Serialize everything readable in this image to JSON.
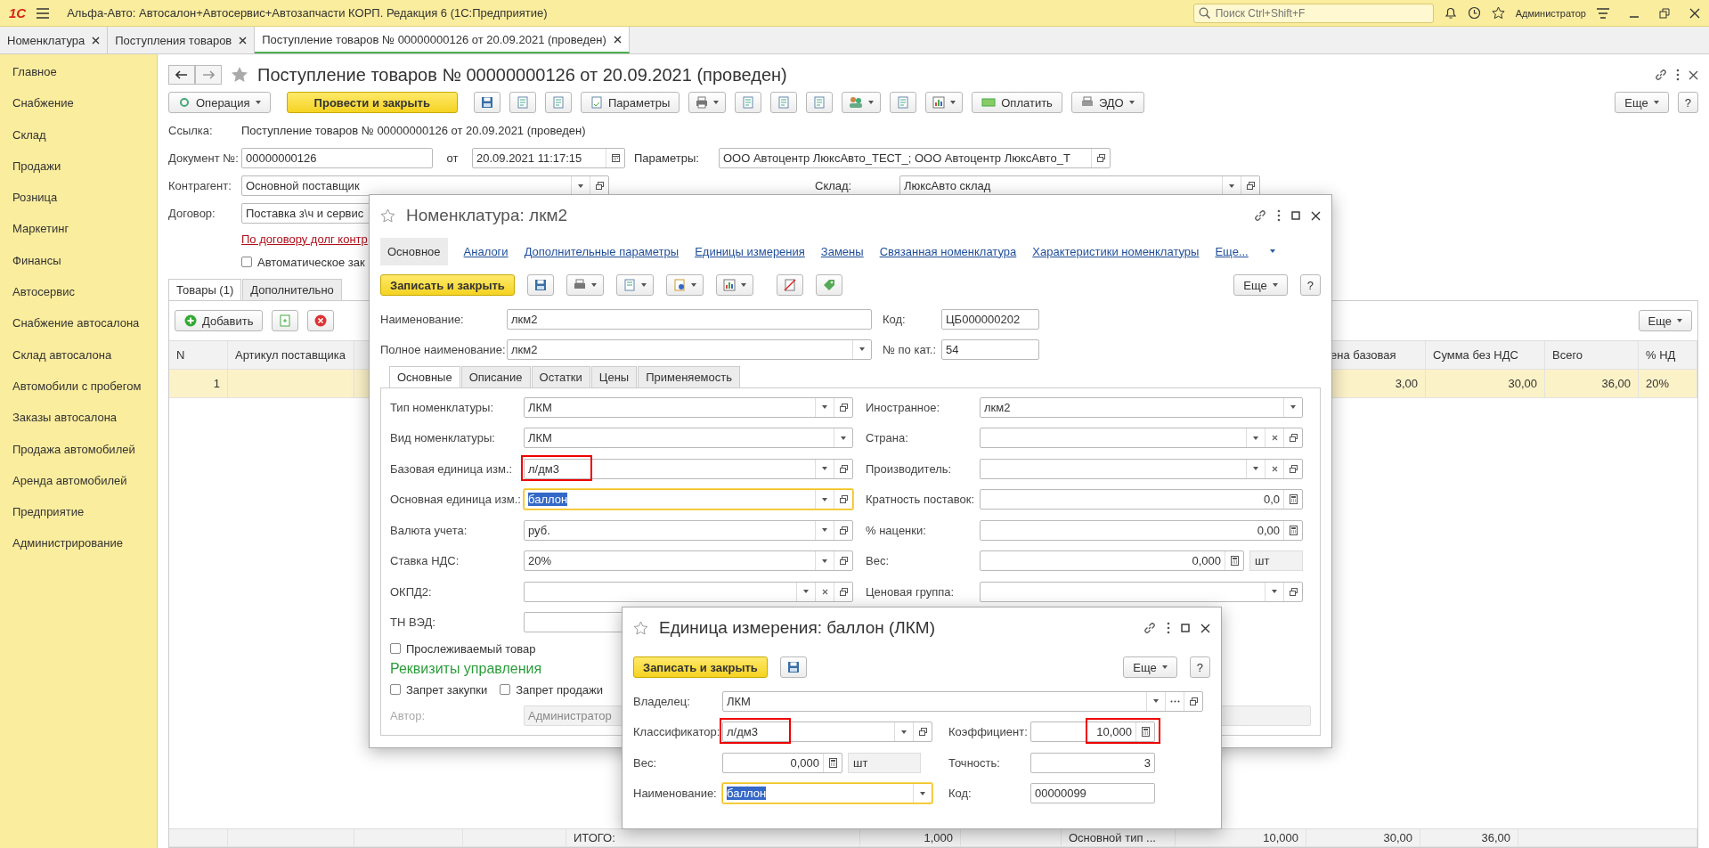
{
  "app_bar": {
    "logo": "1С",
    "title": "Альфа-Авто: Автосалон+Автосервис+Автозапчасти КОРП. Редакция 6  (1С:Предприятие)",
    "search_placeholder": "Поиск Ctrl+Shift+F",
    "user": "Администратор"
  },
  "open_tabs": [
    {
      "label": "Номенклатура",
      "selected": false
    },
    {
      "label": "Поступления товаров",
      "selected": false
    },
    {
      "label": "Поступление товаров № 00000000126 от 20.09.2021 (проведен)",
      "selected": true
    }
  ],
  "sidebar": {
    "items": [
      "Главное",
      "Снабжение",
      "Склад",
      "Продажи",
      "Розница",
      "Маркетинг",
      "Финансы",
      "Автосервис",
      "Снабжение автосалона",
      "Склад автосалона",
      "Автомобили с пробегом",
      "Заказы автосалона",
      "Продажа автомобилей",
      "Аренда автомобилей",
      "Предприятие",
      "Администрирование"
    ]
  },
  "document": {
    "title": "Поступление товаров № 00000000126 от 20.09.2021 (проведен)",
    "toolbar": {
      "operation": "Операция",
      "post": "Провести и закрыть",
      "params": "Параметры",
      "pay": "Оплатить",
      "edo": "ЭДО",
      "more": "Еще",
      "help": "?"
    },
    "link_label": "Ссылка:",
    "link_value": "Поступление товаров № 00000000126 от 20.09.2021 (проведен)",
    "number": {
      "label": "Документ №:",
      "value": "00000000126",
      "kind": "text"
    },
    "date": {
      "label": "от",
      "value": "20.09.2021 11:17:15",
      "kind": "date"
    },
    "params": {
      "label": "Параметры:",
      "value": "ООО Автоцентр ЛюксАвто_ТЕСТ_; ООО Автоцентр ЛюксАвто_Т",
      "kind": "ref"
    },
    "counterparty": {
      "label": "Контрагент:",
      "value": "Основной поставщик",
      "kind": "combo"
    },
    "warehouse": {
      "label": "Склад:",
      "value": "ЛюксАвто склад",
      "kind": "combo"
    },
    "contract": {
      "label": "Договор:",
      "value": "Поставка з\\ч и сервис",
      "kind": "text"
    },
    "debt_link": "По договору долг контр",
    "auto_checkbox": {
      "label": "Автоматическое зак",
      "checked": false
    },
    "tabs": [
      {
        "label": "Товары (1)",
        "selected": true
      },
      {
        "label": "Дополнительно",
        "selected": false
      }
    ],
    "table_toolbar": {
      "add": "Добавить",
      "more": "Еще"
    },
    "table": {
      "columns": [
        "N",
        "Артикул поставщика",
        "ена базовая",
        "Сумма без НДС",
        "Всего",
        "% НД"
      ],
      "rows": [
        {
          "cells": [
            "1",
            "",
            "3,00",
            "30,00",
            "36,00",
            "20%"
          ],
          "selected": true
        }
      ],
      "totals": [
        "ИТОГО:",
        "1,000",
        "Основной тип ...",
        "10,000",
        "30,00",
        "36,00"
      ]
    }
  },
  "item_window": {
    "title": "Номенклатура: лкм2",
    "sections": [
      {
        "label": "Основное",
        "selected": true
      },
      {
        "label": "Аналоги",
        "selected": false
      },
      {
        "label": "Дополнительные параметры",
        "selected": false
      },
      {
        "label": "Единицы измерения",
        "selected": false
      },
      {
        "label": "Замены",
        "selected": false
      },
      {
        "label": "Связанная номенклатура",
        "selected": false
      },
      {
        "label": "Характеристики номенклатуры",
        "selected": false
      },
      {
        "label": "Еще...",
        "selected": false
      }
    ],
    "save_close": "Записать и закрыть",
    "more": "Еще",
    "help": "?",
    "name": {
      "label": "Наименование:",
      "value": "лкм2",
      "kind": "text"
    },
    "full_name": {
      "label": "Полное наименование:",
      "value": "лкм2",
      "kind": "list"
    },
    "code": {
      "label": "Код:",
      "value": "ЦБ000000202",
      "kind": "text"
    },
    "catalog_no": {
      "label": "№ по кат.:",
      "value": "54",
      "kind": "text"
    },
    "tabs": [
      {
        "label": "Основные",
        "selected": true
      },
      {
        "label": "Описание",
        "selected": false
      },
      {
        "label": "Остатки",
        "selected": false
      },
      {
        "label": "Цены",
        "selected": false
      },
      {
        "label": "Применяемость",
        "selected": false
      }
    ],
    "left_fields": [
      {
        "label": "Тип номенклатуры:",
        "value": "ЛКМ",
        "kind": "combo",
        "focused": false,
        "marked": false
      },
      {
        "label": "Вид номенклатуры:",
        "value": "ЛКМ",
        "kind": "list",
        "focused": false,
        "marked": false
      },
      {
        "label": "Базовая единица изм.:",
        "value": "л/дм3",
        "kind": "combo",
        "focused": false,
        "marked": true
      },
      {
        "label": "Основная единица изм.:",
        "value": "баллон",
        "kind": "combo",
        "focused": true,
        "marked": false
      },
      {
        "label": "Валюта учета:",
        "value": "руб.",
        "kind": "combo",
        "focused": false,
        "marked": false
      },
      {
        "label": "Ставка НДС:",
        "value": "20%",
        "kind": "combo",
        "focused": false,
        "marked": false
      },
      {
        "label": "ОКПД2:",
        "kind": "combox",
        "focused": false,
        "marked": false
      },
      {
        "label": "ТН ВЭД:",
        "kind": "text",
        "focused": false,
        "marked": false
      }
    ],
    "right_fields": [
      {
        "label": "Иностранное:",
        "value": "лкм2",
        "kind": "list"
      },
      {
        "label": "Страна:",
        "kind": "combox"
      },
      {
        "label": "Производитель:",
        "kind": "combox"
      },
      {
        "label": "Кратность поставок:",
        "value": "0,0",
        "kind": "number"
      },
      {
        "label": "% наценки:",
        "value": "0,00",
        "kind": "number"
      },
      {
        "label": "Вес:",
        "value": "0,000",
        "kind": "number",
        "unit": "шт"
      },
      {
        "label": "Ценовая группа:",
        "kind": "combo"
      }
    ],
    "traceable": {
      "label": "Прослеживаемый товар",
      "checked": false
    },
    "mgmt_heading": "Реквизиты управления",
    "mgmt_checkboxes": [
      {
        "label": "Запрет закупки",
        "checked": false
      },
      {
        "label": "Запрет продажи",
        "checked": false
      }
    ],
    "author": {
      "label": "Автор:",
      "value": "Администратор",
      "kind": "disabled"
    }
  },
  "unit_window": {
    "title": "Единица измерения: баллон (ЛКМ)",
    "save_close": "Записать и закрыть",
    "more": "Еще",
    "help": "?",
    "owner": {
      "label": "Владелец:",
      "value": "ЛКМ",
      "kind": "dots"
    },
    "left_fields": [
      {
        "label": "Классификатор:",
        "value": "л/дм3",
        "kind": "combo",
        "focused": false,
        "marked": true
      },
      {
        "label": "Вес:",
        "value": "0,000",
        "kind": "number",
        "unit": "шт",
        "focused": false,
        "marked": false
      },
      {
        "label": "Наименование:",
        "value": "баллон",
        "kind": "list",
        "focused": true,
        "marked": false
      }
    ],
    "right_fields": [
      {
        "label": "Коэффициент:",
        "value": "10,000",
        "kind": "number",
        "focused": false,
        "marked": true
      },
      {
        "label": "Точность:",
        "value": "3",
        "kind": "numeric",
        "focused": false,
        "marked": false
      },
      {
        "label": "Код:",
        "value": "00000099",
        "kind": "text",
        "focused": false,
        "marked": false
      }
    ]
  }
}
